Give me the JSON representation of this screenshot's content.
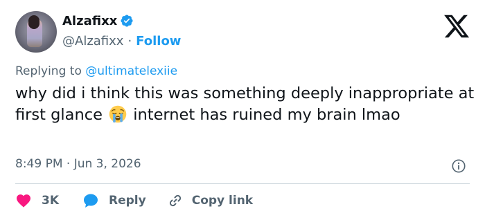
{
  "author": {
    "name": "Alzafixx",
    "handle": "@Alzafixx",
    "follow_label": "Follow",
    "separator": "·"
  },
  "reply_context": {
    "prefix": "Replying to",
    "mention": "@ultimatelexiie"
  },
  "tweet": {
    "text_before_emoji": "why did i think this was something deeply inappropriate at first glance",
    "emoji": "loudly-crying-face",
    "text_after_emoji": "internet has ruined my brain lmao"
  },
  "meta": {
    "timestamp": "8:49 PM · Jun 3, 2026"
  },
  "actions": {
    "like_count": "3K",
    "reply_label": "Reply",
    "copy_link_label": "Copy link"
  },
  "icons": {
    "verified": "verified-badge-icon",
    "platform": "x-logo-icon",
    "info": "info-icon",
    "like": "heart-icon",
    "reply": "speech-bubble-icon",
    "copy": "link-icon"
  },
  "colors": {
    "accent": "#1d9bf0",
    "like": "#f91880",
    "muted": "#536471",
    "text": "#0f1419",
    "divider": "#cfd9de"
  }
}
